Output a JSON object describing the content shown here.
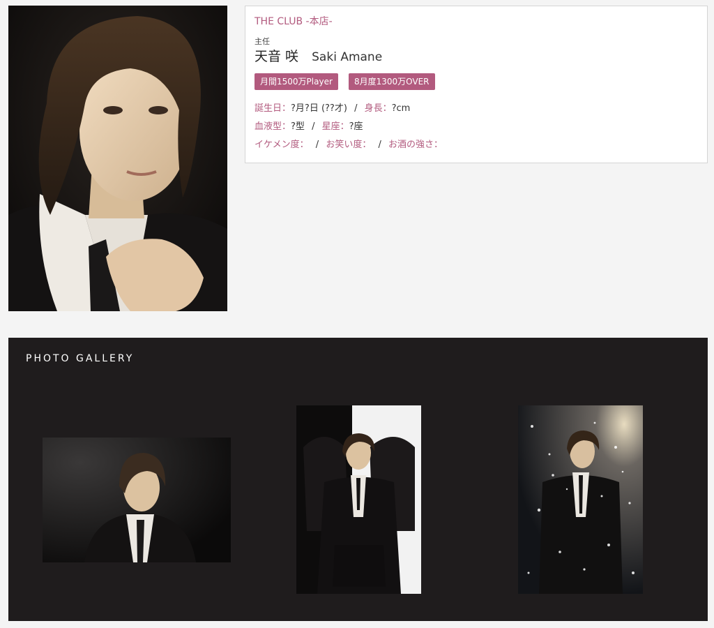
{
  "profile": {
    "shop_name": "THE CLUB -本店-",
    "position": "主任",
    "name_jp": "天音 咲",
    "name_en": "Saki Amane",
    "badges": [
      "月間1500万Player",
      "8月度1300万OVER"
    ],
    "birthday_label": "誕生日",
    "birthday_value": "?月?日 (??才)",
    "height_label": "身長",
    "height_value": "?cm",
    "blood_label": "血液型",
    "blood_value": "?型",
    "zodiac_label": "星座",
    "zodiac_value": "?座",
    "looks_label": "イケメン度",
    "humor_label": "お笑い度",
    "alcohol_label": "お酒の強さ",
    "colon": "：",
    "slash": "/"
  },
  "gallery": {
    "title": "PHOTO GALLERY"
  },
  "colors": {
    "accent": "#b25a7e",
    "gallery_bg": "#1f1c1d",
    "page_bg": "#f4f4f4"
  }
}
